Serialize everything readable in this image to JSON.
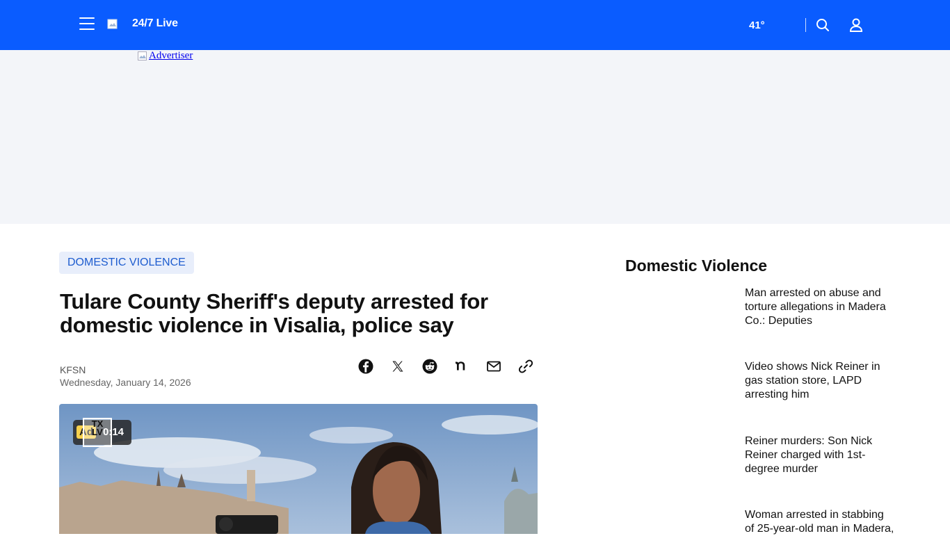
{
  "header": {
    "brand": "24/7 Live",
    "temperature": "41°",
    "accent_color": "#0a5cff"
  },
  "ad": {
    "alt_text": "Advertiser"
  },
  "article": {
    "category": "DOMESTIC VIOLENCE",
    "headline": "Tulare County Sheriff's deputy arrested for domestic violence in Visalia, police say",
    "source": "KFSN",
    "date": "Wednesday, January 14, 2026",
    "share_icons": [
      "facebook-icon",
      "x-icon",
      "reddit-icon",
      "nextdoor-icon",
      "email-icon",
      "link-icon"
    ]
  },
  "video": {
    "ad_label": "Ad",
    "time_remaining": "0:14",
    "logo_text": "TX\nLV"
  },
  "sidebar": {
    "title": "Domestic Violence",
    "items": [
      {
        "label": "Man arrested on abuse and torture allegations in Madera Co.: Deputies"
      },
      {
        "label": "Video shows Nick Reiner in gas station store, LAPD arresting him"
      },
      {
        "label": "Reiner murders: Son Nick Reiner charged with 1st-degree murder"
      },
      {
        "label": "Woman arrested in stabbing of 25-year-old man in Madera,"
      }
    ]
  }
}
